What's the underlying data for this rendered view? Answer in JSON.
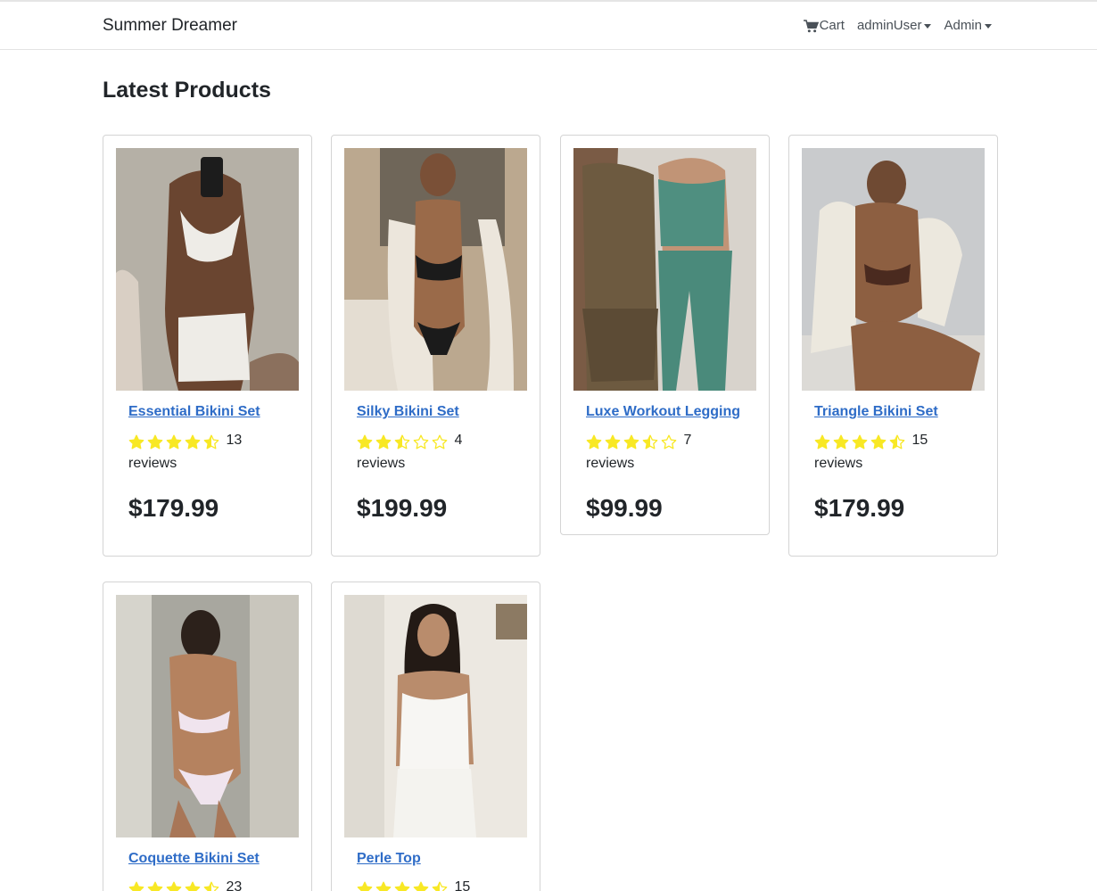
{
  "nav": {
    "brand": "Summer Dreamer",
    "cart_label": "Cart",
    "user_label": "adminUser",
    "admin_label": "Admin"
  },
  "page": {
    "title": "Latest Products"
  },
  "colors": {
    "link": "#2e6cc7",
    "star": "#f8e825"
  },
  "products": [
    {
      "name": "Essential Bikini Set",
      "rating": 4.5,
      "reviews": "13 reviews",
      "price": "$179.99"
    },
    {
      "name": "Silky Bikini Set",
      "rating": 2.5,
      "reviews": "4 reviews",
      "price": "$199.99"
    },
    {
      "name": "Luxe Workout Legging",
      "rating": 3.5,
      "reviews": "7 reviews",
      "price": "$99.99"
    },
    {
      "name": "Triangle Bikini Set",
      "rating": 4.5,
      "reviews": "15 reviews",
      "price": "$179.99"
    },
    {
      "name": "Coquette Bikini Set",
      "rating": 4.5,
      "reviews": "23",
      "price": ""
    },
    {
      "name": "Perle Top",
      "rating": 4.5,
      "reviews": "15",
      "price": ""
    }
  ]
}
